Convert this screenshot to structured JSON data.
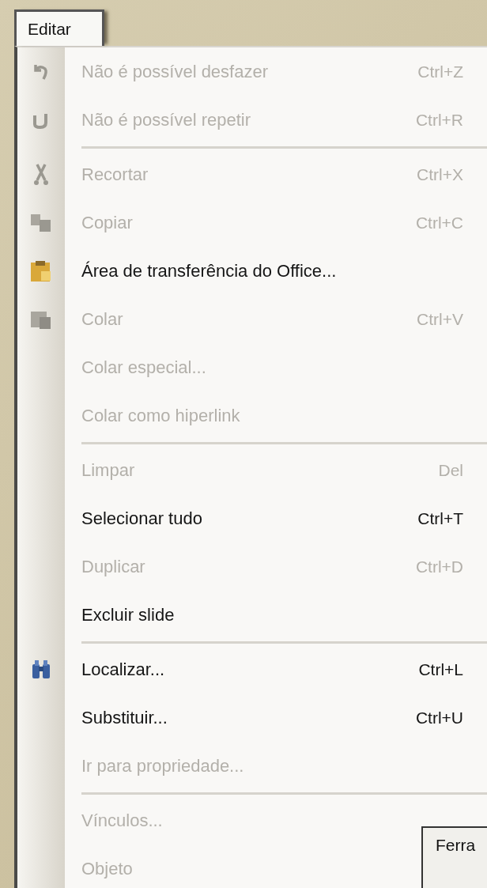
{
  "menu": {
    "title": "Editar",
    "sections": [
      [
        {
          "label": "Não é possível desfazer",
          "shortcut": "Ctrl+Z",
          "disabled": true
        },
        {
          "label": "Não é possível repetir",
          "shortcut": "Ctrl+R",
          "disabled": true
        }
      ],
      [
        {
          "label": "Recortar",
          "shortcut": "Ctrl+X",
          "disabled": true
        },
        {
          "label": "Copiar",
          "shortcut": "Ctrl+C",
          "disabled": true
        },
        {
          "label": "Área de transferência do Office...",
          "disabled": false
        },
        {
          "label": "Colar",
          "shortcut": "Ctrl+V",
          "disabled": true
        },
        {
          "label": "Colar especial...",
          "disabled": true
        },
        {
          "label": "Colar como hiperlink",
          "disabled": true
        }
      ],
      [
        {
          "label": "Limpar",
          "shortcut": "Del",
          "disabled": true
        },
        {
          "label": "Selecionar tudo",
          "shortcut": "Ctrl+T",
          "disabled": false
        },
        {
          "label": "Duplicar",
          "shortcut": "Ctrl+D",
          "disabled": true
        },
        {
          "label": "Excluir slide",
          "disabled": false
        }
      ],
      [
        {
          "label": "Localizar...",
          "shortcut": "Ctrl+L",
          "disabled": false
        },
        {
          "label": "Substituir...",
          "shortcut": "Ctrl+U",
          "disabled": false
        },
        {
          "label": "Ir para propriedade...",
          "disabled": true
        }
      ],
      [
        {
          "label": "Vínculos...",
          "disabled": true
        },
        {
          "label": "Objeto",
          "disabled": true
        }
      ]
    ]
  },
  "toolbar_window": {
    "title": "Ferra"
  }
}
